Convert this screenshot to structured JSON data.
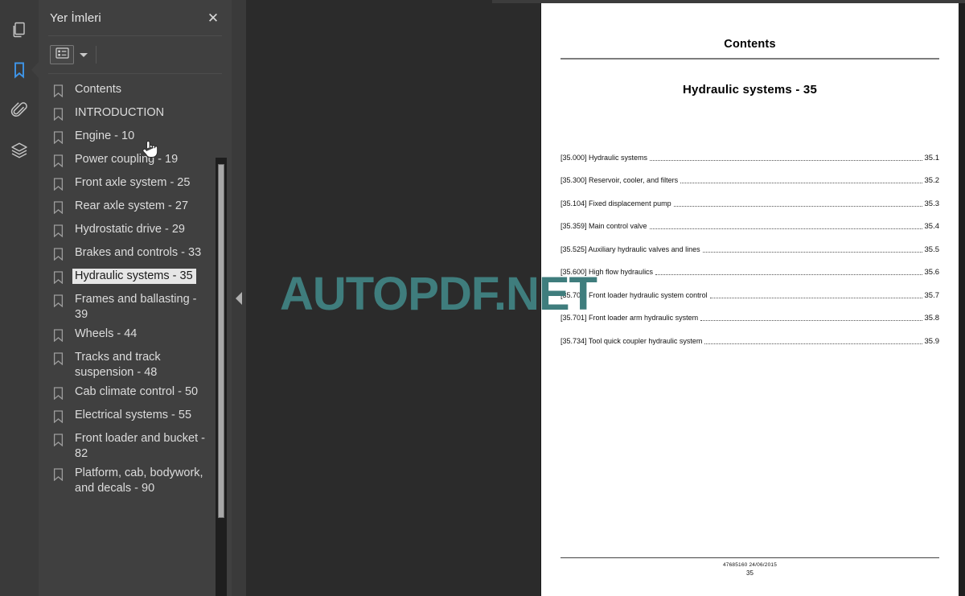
{
  "rail": {
    "items": [
      {
        "name": "thumbnails-icon",
        "title": "Sayfa Küçük Resimleri",
        "active": false
      },
      {
        "name": "bookmark-icon",
        "title": "Yer İmleri",
        "active": true
      },
      {
        "name": "attachment-icon",
        "title": "Ekler",
        "active": false
      },
      {
        "name": "layers-icon",
        "title": "Katmanlar",
        "active": false
      }
    ],
    "active_color": "#4a9eff"
  },
  "panel": {
    "title": "Yer İmleri",
    "close_label": "✕",
    "toolbar": {
      "options_icon": "list-options-icon",
      "caret_icon": "chevron-down-icon"
    },
    "bookmarks": [
      {
        "label": "Contents",
        "selected": false
      },
      {
        "label": "INTRODUCTION",
        "selected": false
      },
      {
        "label": "Engine - 10",
        "selected": false
      },
      {
        "label": "Power coupling - 19",
        "selected": false
      },
      {
        "label": "Front axle system - 25",
        "selected": false
      },
      {
        "label": "Rear axle system - 27",
        "selected": false
      },
      {
        "label": "Hydrostatic drive - 29",
        "selected": false
      },
      {
        "label": "Brakes and controls - 33",
        "selected": false
      },
      {
        "label": "Hydraulic systems - 35",
        "selected": true
      },
      {
        "label": "Frames and ballasting - 39",
        "selected": false
      },
      {
        "label": "Wheels - 44",
        "selected": false
      },
      {
        "label": "Tracks and track suspension - 48",
        "selected": false
      },
      {
        "label": "Cab climate control - 50",
        "selected": false
      },
      {
        "label": "Electrical systems - 55",
        "selected": false
      },
      {
        "label": "Front loader and bucket - 82",
        "selected": false
      },
      {
        "label": "Platform, cab, bodywork, and decals - 90",
        "selected": false
      }
    ]
  },
  "splitter": {
    "collapse_icon": "chevron-left-icon"
  },
  "watermark": {
    "text": "AUTOPDF.NET",
    "color": "#3f7d7d"
  },
  "document": {
    "header": "Contents",
    "subtitle": "Hydraulic systems - 35",
    "toc": [
      {
        "label": "[35.000] Hydraulic systems",
        "page": "35.1"
      },
      {
        "label": "[35.300] Reservoir, cooler, and filters",
        "page": "35.2"
      },
      {
        "label": "[35.104] Fixed displacement pump",
        "page": "35.3"
      },
      {
        "label": "[35.359] Main control valve",
        "page": "35.4"
      },
      {
        "label": "[35.525] Auxiliary hydraulic valves and lines",
        "page": "35.5"
      },
      {
        "label": "[35.600] High flow hydraulics",
        "page": "35.6"
      },
      {
        "label": "[35.701] Front loader hydraulic system control",
        "page": "35.7"
      },
      {
        "label": "[35.701] Front loader arm hydraulic system",
        "page": "35.8"
      },
      {
        "label": "[35.734] Tool quick coupler hydraulic system",
        "page": "35.9"
      }
    ],
    "footer_line1": "47685160 24/06/2015",
    "footer_line2": "35"
  }
}
